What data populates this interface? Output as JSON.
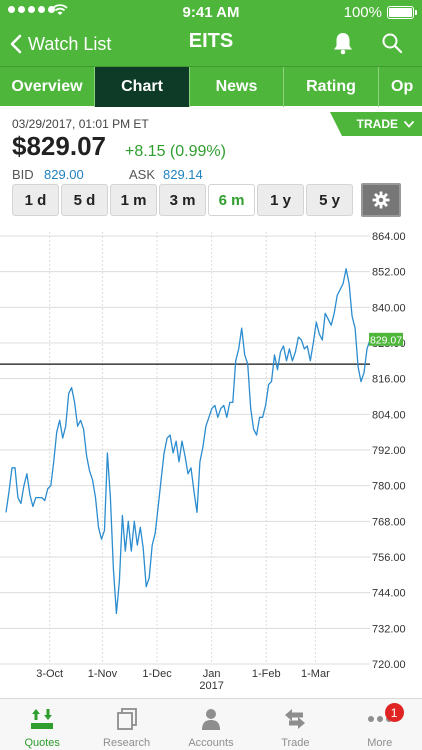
{
  "status_bar": {
    "time": "9:41 AM",
    "battery": "100%"
  },
  "nav": {
    "back_label": "Watch List",
    "title": "EITS"
  },
  "tabs": [
    {
      "label": "Overview",
      "active": false
    },
    {
      "label": "Chart",
      "active": true
    },
    {
      "label": "News",
      "active": false
    },
    {
      "label": "Rating",
      "active": false
    },
    {
      "label": "Op",
      "active": false
    }
  ],
  "quote": {
    "datetime": "03/29/2017, 01:01 PM ET",
    "price": "$829.07",
    "change": "+8.15 (0.99%)",
    "bid_label": "BID",
    "bid": "829.00",
    "ask_label": "ASK",
    "ask": "829.14",
    "trade_label": "TRADE"
  },
  "ranges": [
    {
      "label": "1 d",
      "selected": false
    },
    {
      "label": "5 d",
      "selected": false
    },
    {
      "label": "1 m",
      "selected": false
    },
    {
      "label": "3 m",
      "selected": false
    },
    {
      "label": "6 m",
      "selected": true
    },
    {
      "label": "1 y",
      "selected": false
    },
    {
      "label": "5 y",
      "selected": false
    }
  ],
  "colors": {
    "accent_green": "#4fb63c",
    "active_tab": "#0e3b27",
    "line_blue": "#2b8ccf",
    "positive": "#2e9e2e"
  },
  "chart_data": {
    "type": "line",
    "ylim": [
      720,
      864
    ],
    "yticks": [
      "864.00",
      "852.00",
      "840.00",
      "828.00",
      "816.00",
      "804.00",
      "792.00",
      "780.00",
      "768.00",
      "756.00",
      "744.00",
      "732.00",
      "720.00"
    ],
    "xticks": [
      {
        "label": "3-Oct",
        "sub": "",
        "t": 0.12
      },
      {
        "label": "1-Nov",
        "sub": "",
        "t": 0.265
      },
      {
        "label": "1-Dec",
        "sub": "",
        "t": 0.415
      },
      {
        "label": "Jan",
        "sub": "2017",
        "t": 0.565
      },
      {
        "label": "1-Feb",
        "sub": "",
        "t": 0.715
      },
      {
        "label": "1-Mar",
        "sub": "",
        "t": 0.85
      }
    ],
    "last_price_label": "829.07",
    "last_price_value": 829.07,
    "reference_value": 820.9,
    "series": [
      {
        "values": [
          771,
          778,
          786,
          786,
          776,
          774,
          780,
          784,
          777,
          773,
          776,
          776,
          776,
          775,
          779,
          780,
          788,
          798,
          802,
          796,
          800,
          811,
          813,
          808,
          800,
          802,
          799,
          790,
          785,
          782,
          776,
          766,
          762,
          765,
          791,
          776,
          752,
          737,
          748,
          770,
          758,
          768,
          758,
          768,
          760,
          766,
          759,
          746,
          749,
          760,
          764,
          773,
          782,
          791,
          796,
          797,
          791,
          795,
          788,
          795,
          790,
          784,
          786,
          778,
          771,
          788,
          793,
          800,
          803,
          806,
          807,
          803,
          806,
          807,
          803,
          808,
          808,
          822,
          826,
          833,
          824,
          821,
          806,
          799,
          797,
          803,
          803,
          807,
          814,
          815,
          824,
          819,
          825,
          827,
          822,
          826,
          822,
          825,
          830,
          829,
          826,
          827,
          822,
          828,
          835,
          831,
          829,
          838,
          836,
          834,
          838,
          844,
          846,
          848,
          853,
          848,
          837,
          833,
          820,
          815,
          818,
          826,
          829.07
        ]
      }
    ]
  },
  "bottom_bar": [
    {
      "label": "Quotes",
      "icon": "quotes-icon",
      "active": true
    },
    {
      "label": "Research",
      "icon": "research-icon",
      "active": false
    },
    {
      "label": "Accounts",
      "icon": "accounts-icon",
      "active": false
    },
    {
      "label": "Trade",
      "icon": "trade-icon",
      "active": false
    },
    {
      "label": "More",
      "icon": "more-icon",
      "active": false,
      "badge": "1"
    }
  ]
}
